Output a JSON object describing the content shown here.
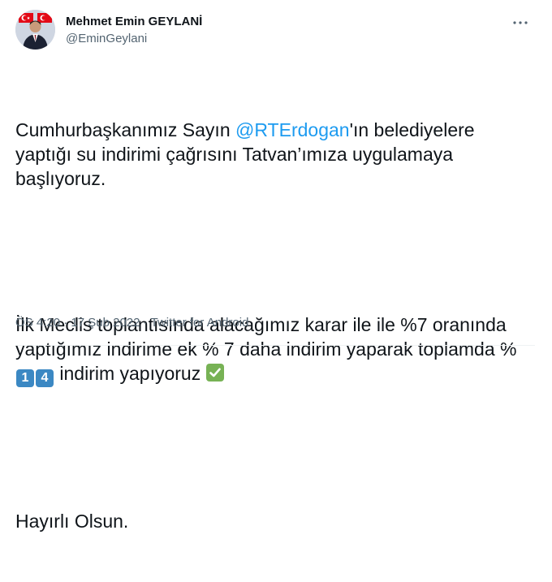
{
  "author": {
    "name": "Mehmet Emin GEYLANİ",
    "handle": "@EminGeylani"
  },
  "tweet": {
    "p1_before": "Cumhurbaşkanımız Sayın ",
    "p1_mention": "@RTErdogan",
    "p1_after": "'ın belediyelere yaptığı su indirimi çağrısını Tatvan’ımıza uygulamaya başlıyoruz.",
    "p2_before": "İlk Meclis toplantısında alacağımız karar ile ile %7 oranında yaptığımız indirime ek % 7 daha indirim yaparak toplamda % ",
    "p2_key1": "1",
    "p2_key2": "4",
    "p2_after": " indirim yapıyoruz ",
    "p3": "Hayırlı Olsun."
  },
  "meta": {
    "time": "ÖS 4:20",
    "sep1": " · ",
    "date": "17 Şub 2022",
    "sep2": " · ",
    "source": "Twitter for Android"
  },
  "icons": {
    "more": "more-icon",
    "check": "check-mark-icon",
    "keycap": "keycap-digit-icon"
  },
  "colors": {
    "mention": "#1d9bf0",
    "secondary_text": "#536471",
    "keycap_bg": "#3b88c3",
    "check_bg": "#77b255"
  }
}
